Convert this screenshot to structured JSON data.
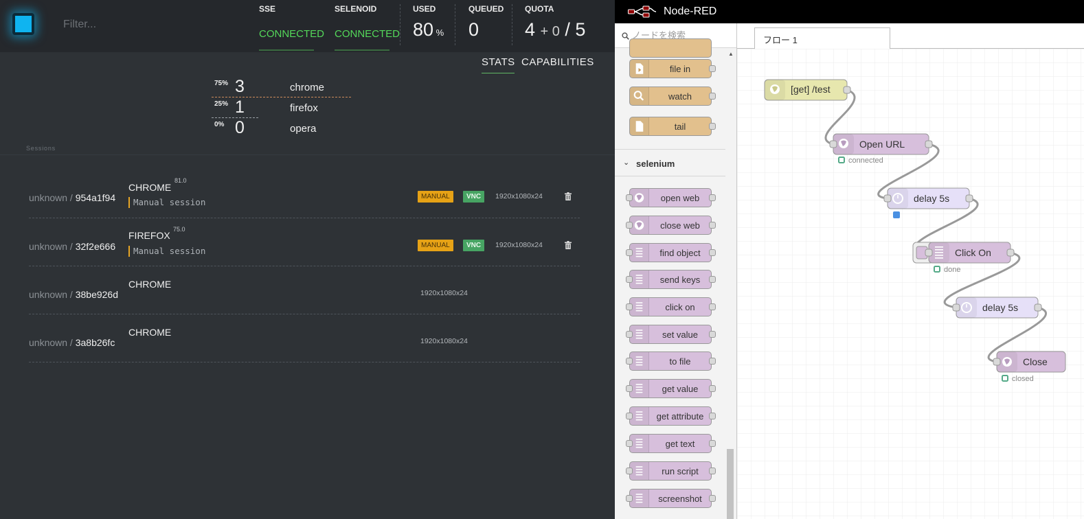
{
  "selenoid": {
    "filter_placeholder": "Filter...",
    "stats": {
      "sse_label": "SSE",
      "sse_status": "CONNECTED",
      "selenoid_label": "SELENOID",
      "selenoid_status": "CONNECTED",
      "used_label": "USED",
      "used_value": "80",
      "used_unit": "%",
      "queued_label": "QUEUED",
      "queued_value": "0",
      "quota_label": "QUOTA",
      "quota_used": "4",
      "quota_plus": "+ 0",
      "quota_total": "/ 5"
    },
    "tabs": [
      "STATS",
      "CAPABILITIES"
    ],
    "browsers": [
      {
        "pct": "75%",
        "count": "3",
        "name": "chrome"
      },
      {
        "pct": "25%",
        "count": "1",
        "name": "firefox"
      },
      {
        "pct": "0%",
        "count": "0",
        "name": "opera"
      }
    ],
    "sessions_label": "Sessions",
    "sessions": [
      {
        "user": "unknown",
        "id": "954a1f94",
        "browser": "CHROME",
        "version": "81.0",
        "name": "Manual session",
        "manual": "MANUAL",
        "vnc": "VNC",
        "resolution": "1920x1080x24"
      },
      {
        "user": "unknown",
        "id": "32f2e666",
        "browser": "FIREFOX",
        "version": "75.0",
        "name": "Manual session",
        "manual": "MANUAL",
        "vnc": "VNC",
        "resolution": "1920x1080x24"
      },
      {
        "user": "unknown",
        "id": "38be926d",
        "browser": "CHROME",
        "resolution": "1920x1080x24"
      },
      {
        "user": "unknown",
        "id": "3a8b26fc",
        "browser": "CHROME",
        "resolution": "1920x1080x24"
      }
    ],
    "colors": {
      "accent": "#0fb4f0",
      "connected": "#54d85a",
      "manual": "#e6a216",
      "vnc": "#47a463"
    }
  },
  "nodered": {
    "title": "Node-RED",
    "search_placeholder": "ノードを検索",
    "storage_nodes": [
      "file in",
      "watch",
      "tail"
    ],
    "category": "selenium",
    "selenium_nodes": [
      "open web",
      "close web",
      "find object",
      "send keys",
      "click on",
      "set value",
      "to file",
      "get value",
      "get attribute",
      "get text",
      "run script",
      "screenshot"
    ],
    "tab": "フロー 1",
    "flow_nodes": [
      {
        "label": "[get] /test",
        "icon": "globe-icon"
      },
      {
        "label": "Open URL",
        "icon": "globe-icon",
        "status": "connected"
      },
      {
        "label": "delay 5s",
        "icon": "timer-icon"
      },
      {
        "label": "Click On",
        "icon": "list-icon",
        "status": "done"
      },
      {
        "label": "delay 5s",
        "icon": "timer-icon"
      },
      {
        "label": "Close",
        "icon": "globe-icon",
        "status": "closed"
      }
    ],
    "colors": {
      "selenium": "#d7bfdc",
      "storage": "#e2c08d",
      "http_in": "#e7e7ae",
      "delay": "#e6e0f8",
      "status_green": "#5a8",
      "status_blue": "#4a90e2"
    }
  }
}
